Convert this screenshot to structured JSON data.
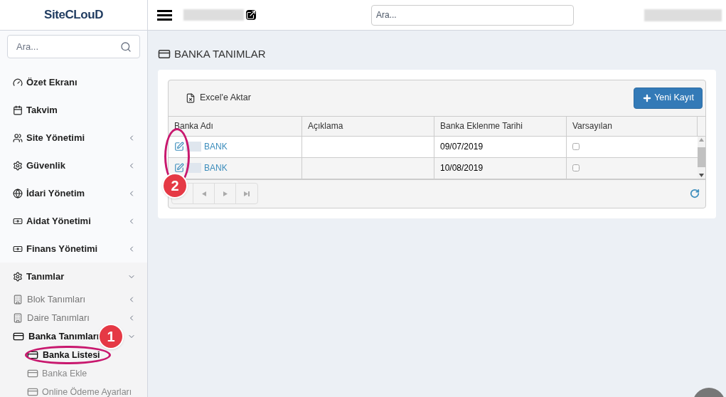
{
  "logo": {
    "text": "SiteCLouD"
  },
  "header": {
    "search": {
      "placeholder": "Ara..."
    }
  },
  "sidebar": {
    "search": {
      "placeholder": "Ara..."
    },
    "items": [
      {
        "label": "Özet Ekranı",
        "kind": "link"
      },
      {
        "label": "Takvim",
        "kind": "link"
      },
      {
        "label": "Site Yönetimi",
        "kind": "group",
        "expanded": false
      },
      {
        "label": "Güvenlik",
        "kind": "group",
        "expanded": false
      },
      {
        "label": "İdari Yönetim",
        "kind": "group",
        "expanded": false
      },
      {
        "label": "Aidat Yönetimi",
        "kind": "group",
        "expanded": false
      },
      {
        "label": "Finans Yönetimi",
        "kind": "group",
        "expanded": false
      },
      {
        "label": "Tanımlar",
        "kind": "group",
        "expanded": true,
        "children": [
          {
            "label": "Blok Tanımları",
            "expanded": false
          },
          {
            "label": "Daire Tanımları",
            "expanded": false
          },
          {
            "label": "Banka Tanımları",
            "expanded": true,
            "children": [
              {
                "label": "Banka Listesi",
                "selected": true
              },
              {
                "label": "Banka Ekle",
                "selected": false
              },
              {
                "label": "Online Ödeme Ayarları",
                "selected": false
              }
            ]
          }
        ]
      }
    ]
  },
  "page": {
    "title": "BANKA TANIMLAR",
    "toolbar": {
      "export": "Excel'e Aktar",
      "new": "Yeni Kayıt"
    },
    "table": {
      "columns": [
        "Banka Adı",
        "Açıklama",
        "Banka Eklenme Tarihi",
        "Varsayılan"
      ],
      "rows": [
        {
          "name": "BANK",
          "description": "",
          "date": "09/07/2019",
          "default": false
        },
        {
          "name": "BANK",
          "description": "",
          "date": "10/08/2019",
          "default": false
        }
      ]
    }
  },
  "callouts": [
    {
      "number": "1"
    },
    {
      "number": "2"
    }
  ]
}
